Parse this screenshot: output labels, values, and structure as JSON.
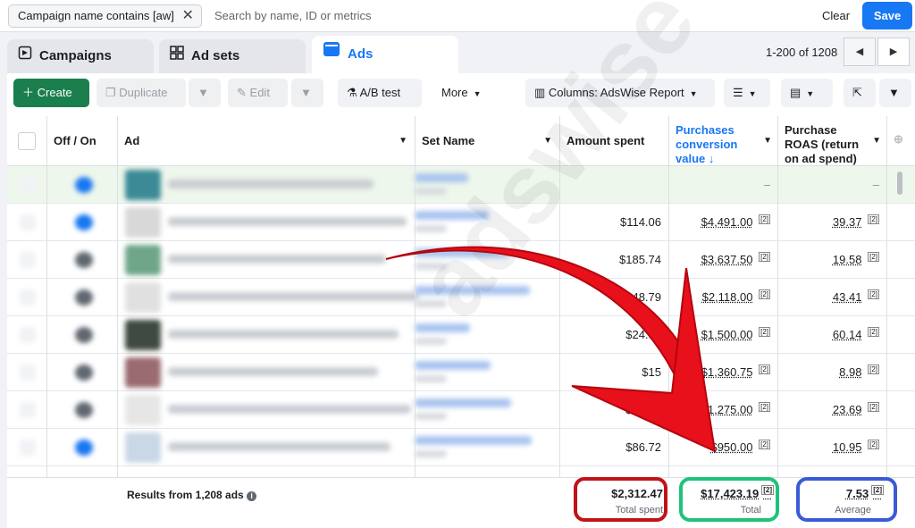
{
  "filter": {
    "chip_label": "Campaign name contains [aw]",
    "search_placeholder": "Search by name, ID or metrics",
    "clear_label": "Clear",
    "save_label": "Save"
  },
  "tabs": [
    {
      "label": "Campaigns"
    },
    {
      "label": "Ad sets"
    },
    {
      "label": "Ads"
    }
  ],
  "pager": {
    "range": "1-200 of 1208"
  },
  "toolbar": {
    "create": "Create",
    "duplicate": "Duplicate",
    "edit": "Edit",
    "ab_test": "A/B test",
    "more": "More",
    "columns": "Columns: AdsWise Report"
  },
  "table": {
    "headers": {
      "off_on": "Off / On",
      "ad": "Ad",
      "set_name": "Set Name",
      "amount_spent": "Amount spent",
      "purchases_value": "Purchases conversion value",
      "roas": "Purchase ROAS (return on ad spend)"
    },
    "rows": [
      {
        "spent": "",
        "value": "–",
        "roas": "–"
      },
      {
        "spent": "$114.06",
        "value": "$4,491.00",
        "roas": "39.37"
      },
      {
        "spent": "$185.74",
        "value": "$3,637.50",
        "roas": "19.58"
      },
      {
        "spent": "$48.79",
        "value": "$2,118.00",
        "roas": "43.41"
      },
      {
        "spent": "$24.94",
        "value": "$1,500.00",
        "roas": "60.14"
      },
      {
        "spent": "$15",
        "value": "$1,360.75",
        "roas": "8.98"
      },
      {
        "spent": "$68.81",
        "value": "$1,275.00",
        "roas": "23.69"
      },
      {
        "spent": "$86.72",
        "value": "$950.00",
        "roas": "10.95"
      }
    ],
    "footnote": "[2]"
  },
  "footer": {
    "results": "Results from 1,208 ads",
    "total_spent": "$2,312.47",
    "total_spent_label": "Total spent",
    "total_value": "$17,423.19",
    "total_value_label": "Total",
    "avg_roas": "7.53",
    "avg_roas_label": "Average"
  },
  "watermark": "adswise",
  "colors": {
    "primary": "#1877f2",
    "create": "#1a7f4d",
    "arrow": "#e8101a",
    "box_red": "#c01418",
    "box_green": "#1fc27a",
    "box_blue": "#3a5bd6"
  }
}
